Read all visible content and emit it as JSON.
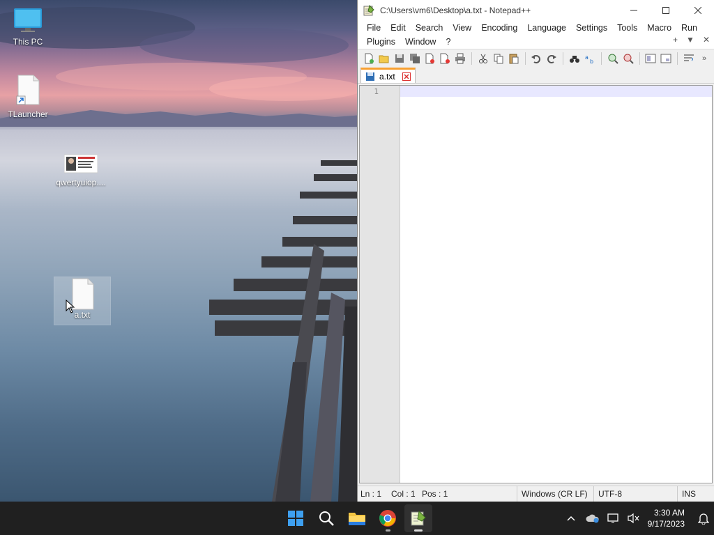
{
  "desktop": {
    "icons": [
      {
        "label": "This PC"
      },
      {
        "label": "TLauncher"
      },
      {
        "label": "qwertyuiop...."
      },
      {
        "label": "a.txt"
      }
    ]
  },
  "notepad": {
    "title": "C:\\Users\\vm6\\Desktop\\a.txt - Notepad++",
    "menu_row1": [
      "File",
      "Edit",
      "Search",
      "View",
      "Encoding",
      "Language",
      "Settings",
      "Tools",
      "Macro",
      "Run"
    ],
    "menu_row2": [
      "Plugins",
      "Window",
      "?"
    ],
    "menu_right": {
      "plus": "+",
      "down": "▼",
      "close": "✕"
    },
    "tab": {
      "label": "a.txt"
    },
    "line_numbers": [
      "1"
    ],
    "status": {
      "ln": "Ln : 1",
      "col": "Col : 1",
      "pos": "Pos : 1",
      "eol": "Windows (CR LF)",
      "encoding": "UTF-8",
      "mode": "INS"
    }
  },
  "taskbar": {
    "time": "3:30 AM",
    "date": "9/17/2023"
  }
}
